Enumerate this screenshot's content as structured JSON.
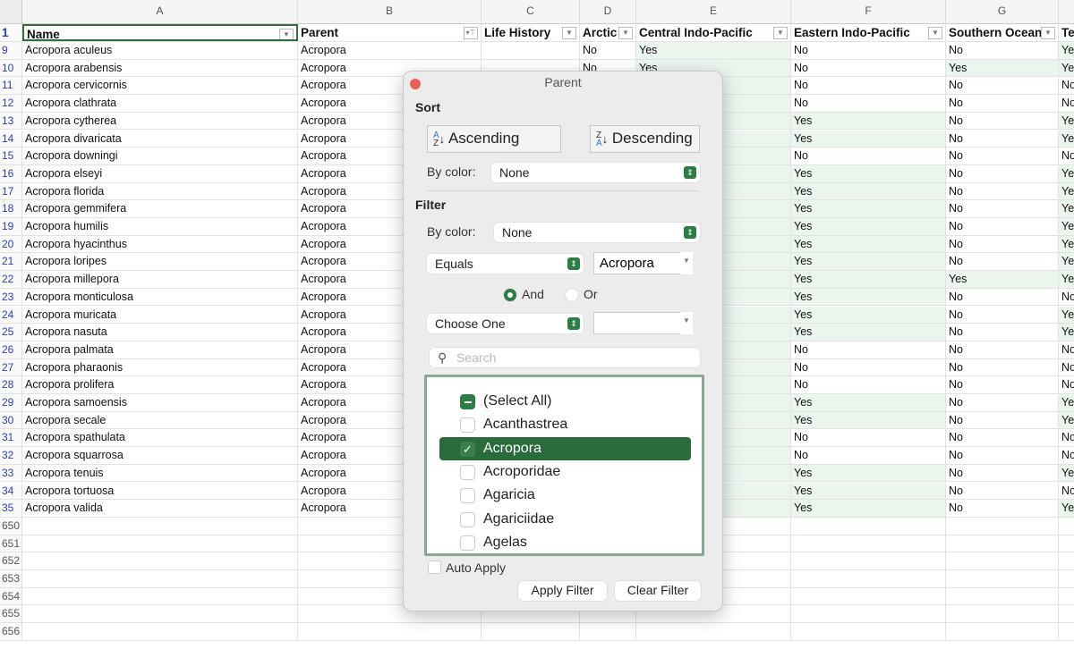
{
  "columns": [
    "A",
    "B",
    "C",
    "D",
    "E",
    "F",
    "G",
    ""
  ],
  "headers": [
    "Name",
    "Parent",
    "Life History",
    "Arctic",
    "Central Indo-Pacific",
    "Eastern Indo-Pacific",
    "Southern Ocean",
    "Te"
  ],
  "rows": [
    {
      "n": "9",
      "name": "Acropora aculeus",
      "parent": "Acropora",
      "d": "No",
      "e": "Yes",
      "f": "No",
      "g": "No",
      "h": "Yes"
    },
    {
      "n": "10",
      "name": "Acropora arabensis",
      "parent": "Acropora",
      "d": "No",
      "e": "Yes",
      "f": "No",
      "g": "Yes",
      "h": "Yes"
    },
    {
      "n": "11",
      "name": "Acropora cervicornis",
      "parent": "Acropora",
      "f": "No",
      "g": "No",
      "h": "No"
    },
    {
      "n": "12",
      "name": "Acropora clathrata",
      "parent": "Acropora",
      "f": "No",
      "g": "No",
      "h": "No"
    },
    {
      "n": "13",
      "name": "Acropora cytherea",
      "parent": "Acropora",
      "f": "Yes",
      "g": "No",
      "h": "Yes"
    },
    {
      "n": "14",
      "name": "Acropora divaricata",
      "parent": "Acropora",
      "f": "Yes",
      "g": "No",
      "h": "Yes"
    },
    {
      "n": "15",
      "name": "Acropora downingi",
      "parent": "Acropora",
      "f": "No",
      "g": "No",
      "h": "No"
    },
    {
      "n": "16",
      "name": "Acropora elseyi",
      "parent": "Acropora",
      "f": "Yes",
      "g": "No",
      "h": "Yes"
    },
    {
      "n": "17",
      "name": "Acropora florida",
      "parent": "Acropora",
      "f": "Yes",
      "g": "No",
      "h": "Yes"
    },
    {
      "n": "18",
      "name": "Acropora gemmifera",
      "parent": "Acropora",
      "f": "Yes",
      "g": "No",
      "h": "Yes"
    },
    {
      "n": "19",
      "name": "Acropora humilis",
      "parent": "Acropora",
      "f": "Yes",
      "g": "No",
      "h": "Yes"
    },
    {
      "n": "20",
      "name": "Acropora hyacinthus",
      "parent": "Acropora",
      "f": "Yes",
      "g": "No",
      "h": "Yes"
    },
    {
      "n": "21",
      "name": "Acropora loripes",
      "parent": "Acropora",
      "f": "Yes",
      "g": "No",
      "h": "Yes"
    },
    {
      "n": "22",
      "name": "Acropora millepora",
      "parent": "Acropora",
      "f": "Yes",
      "g": "Yes",
      "h": "Yes"
    },
    {
      "n": "23",
      "name": "Acropora monticulosa",
      "parent": "Acropora",
      "f": "Yes",
      "g": "No",
      "h": "No"
    },
    {
      "n": "24",
      "name": "Acropora muricata",
      "parent": "Acropora",
      "f": "Yes",
      "g": "No",
      "h": "Yes"
    },
    {
      "n": "25",
      "name": "Acropora nasuta",
      "parent": "Acropora",
      "f": "Yes",
      "g": "No",
      "h": "Yes"
    },
    {
      "n": "26",
      "name": "Acropora palmata",
      "parent": "Acropora",
      "f": "No",
      "g": "No",
      "h": "No"
    },
    {
      "n": "27",
      "name": "Acropora pharaonis",
      "parent": "Acropora",
      "f": "No",
      "g": "No",
      "h": "No"
    },
    {
      "n": "28",
      "name": "Acropora prolifera",
      "parent": "Acropora",
      "f": "No",
      "g": "No",
      "h": "No"
    },
    {
      "n": "29",
      "name": "Acropora samoensis",
      "parent": "Acropora",
      "f": "Yes",
      "g": "No",
      "h": "Yes"
    },
    {
      "n": "30",
      "name": "Acropora secale",
      "parent": "Acropora",
      "f": "Yes",
      "g": "No",
      "h": "Yes"
    },
    {
      "n": "31",
      "name": "Acropora spathulata",
      "parent": "Acropora",
      "f": "No",
      "g": "No",
      "h": "No"
    },
    {
      "n": "32",
      "name": "Acropora squarrosa",
      "parent": "Acropora",
      "f": "No",
      "g": "No",
      "h": "No"
    },
    {
      "n": "33",
      "name": "Acropora tenuis",
      "parent": "Acropora",
      "f": "Yes",
      "g": "No",
      "h": "Yes"
    },
    {
      "n": "34",
      "name": "Acropora tortuosa",
      "parent": "Acropora",
      "f": "Yes",
      "g": "No",
      "h": "No"
    },
    {
      "n": "35",
      "name": "Acropora valida",
      "parent": "Acropora",
      "f": "Yes",
      "g": "No",
      "h": "Yes"
    }
  ],
  "empty_rows": [
    "650",
    "651",
    "652",
    "653",
    "654",
    "655",
    "656"
  ],
  "popup": {
    "title": "Parent",
    "sort_label": "Sort",
    "ascending": "Ascending",
    "descending": "Descending",
    "by_color_label": "By color:",
    "sort_by_color": "None",
    "filter_label": "Filter",
    "filter_by_color": "None",
    "condition1": "Equals",
    "value1": "Acropora",
    "and_label": "And",
    "or_label": "Or",
    "and_selected": true,
    "condition2": "Choose One",
    "value2": "",
    "search_placeholder": "Search",
    "items": [
      {
        "label": "(Select All)",
        "state": "mixed"
      },
      {
        "label": "Acanthastrea",
        "state": "unchecked"
      },
      {
        "label": "Acropora",
        "state": "checked"
      },
      {
        "label": "Acroporidae",
        "state": "unchecked"
      },
      {
        "label": "Agaricia",
        "state": "unchecked"
      },
      {
        "label": "Agariciidae",
        "state": "unchecked"
      },
      {
        "label": "Agelas",
        "state": "unchecked"
      }
    ],
    "auto_apply": "Auto Apply",
    "auto_apply_checked": false,
    "apply": "Apply Filter",
    "clear": "Clear Filter"
  },
  "colors": {
    "accent": "#2e7d46",
    "yes_fill": "#eaf5ee",
    "selection": "#2a6b3b"
  }
}
